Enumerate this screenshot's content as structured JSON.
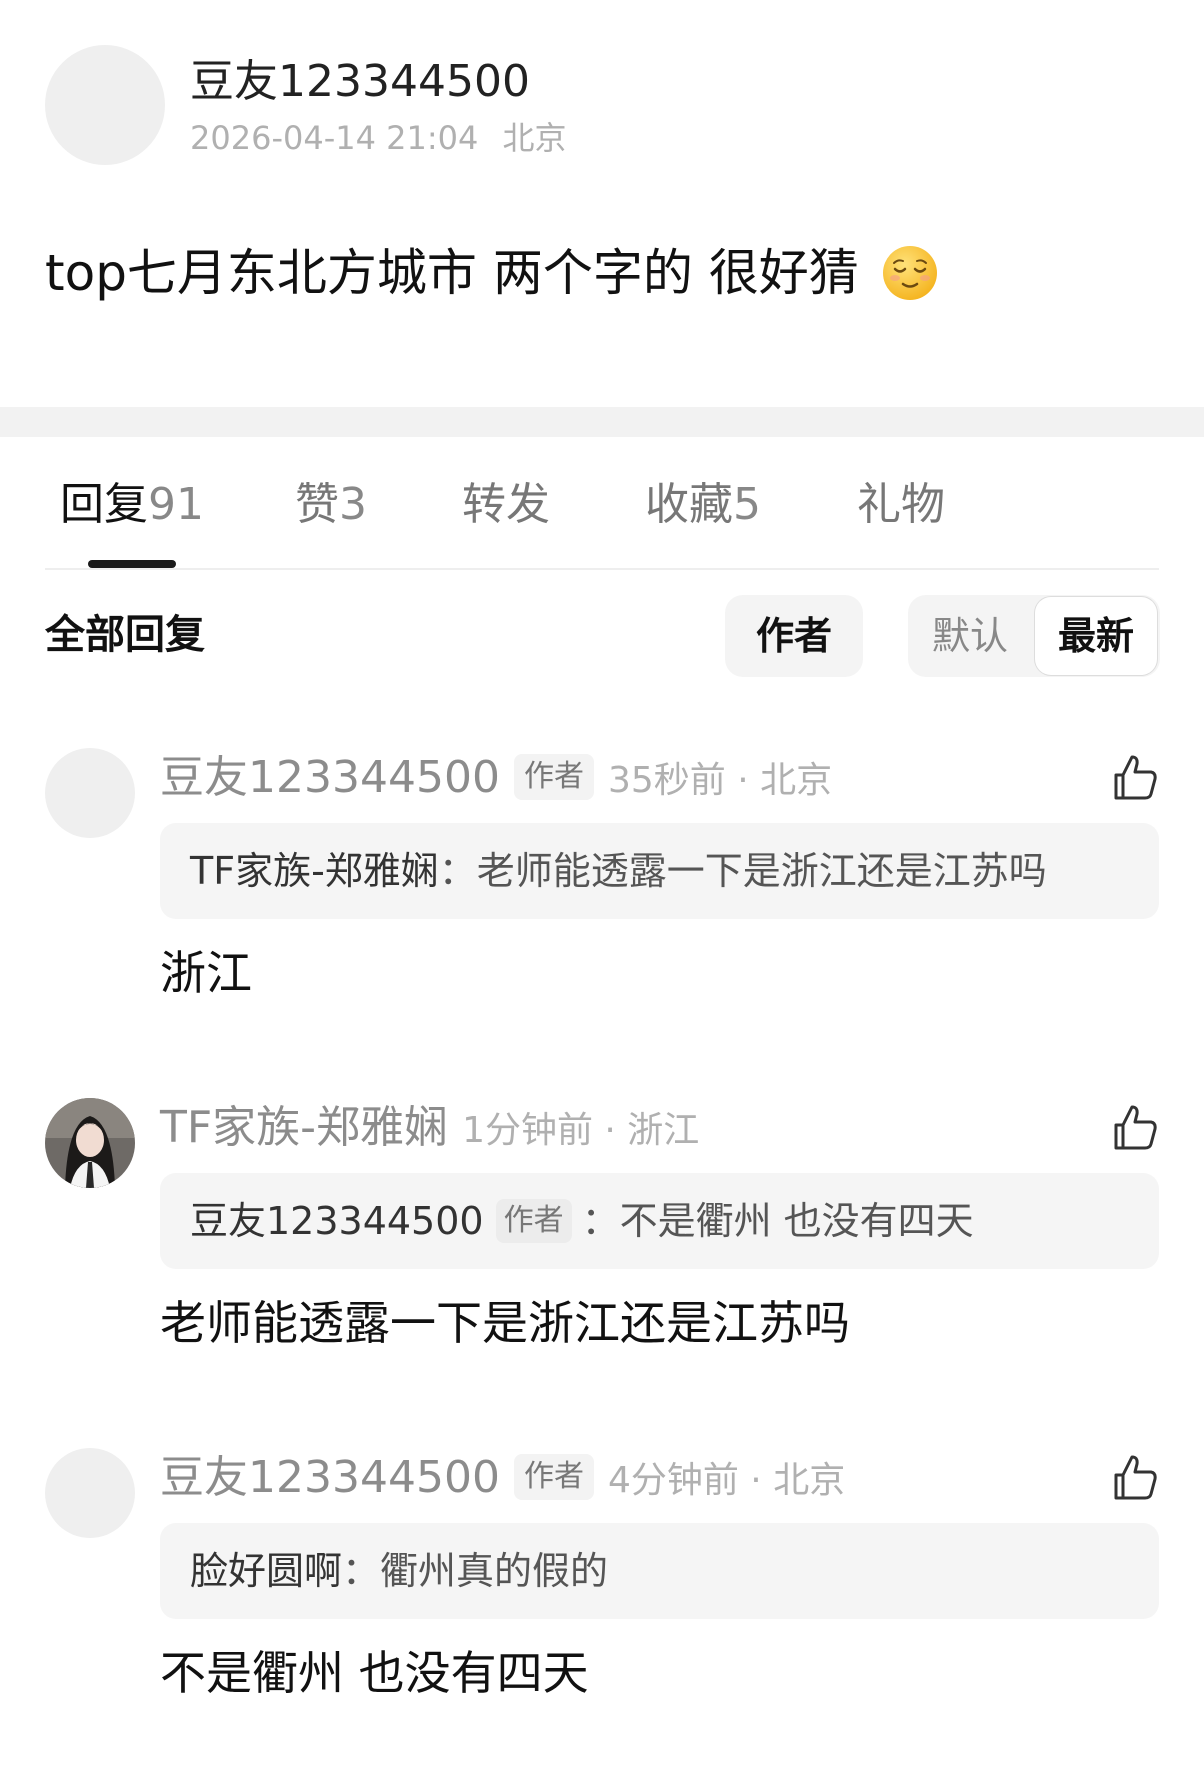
{
  "post": {
    "author": "豆友123344500",
    "timestamp": "2026-04-14 21:04",
    "location": "北京",
    "body": "top七月东北方城市 两个字的 很好猜",
    "emoji": "relieved-face-emoji"
  },
  "tabs": [
    {
      "label": "回复",
      "count": "91",
      "active": true
    },
    {
      "label": "赞",
      "count": "3",
      "active": false
    },
    {
      "label": "转发",
      "count": "",
      "active": false
    },
    {
      "label": "收藏",
      "count": "5",
      "active": false
    },
    {
      "label": "礼物",
      "count": "",
      "active": false
    }
  ],
  "filter": {
    "all_replies_label": "全部回复",
    "author_button": "作者",
    "sort_default": "默认",
    "sort_newest": "最新"
  },
  "comments": [
    {
      "author": "豆友123344500",
      "badge": "作者",
      "time": "35秒前 · 北京",
      "quote_author": "TF家族-郑雅娴",
      "quote_badge": "",
      "quote_text": "：老师能透露一下是浙江还是江苏吗",
      "body": "浙江",
      "avatar": "blank"
    },
    {
      "author": "TF家族-郑雅娴",
      "badge": "",
      "time": "1分钟前 · 浙江",
      "quote_author": "豆友123344500",
      "quote_badge": "作者",
      "quote_text": "：不是衢州 也没有四天",
      "body": "老师能透露一下是浙江还是江苏吗",
      "avatar": "photo"
    },
    {
      "author": "豆友123344500",
      "badge": "作者",
      "time": "4分钟前 · 北京",
      "quote_author": "脸好圆啊",
      "quote_badge": "",
      "quote_text": "：衢州真的假的",
      "body": "不是衢州 也没有四天",
      "avatar": "blank"
    }
  ],
  "icons": {
    "like": "thumbs-up-icon"
  },
  "colors": {
    "background": "#ffffff",
    "muted_text": "#b0b0b0",
    "badge_bg": "#f3f3f3",
    "quote_bg": "#f5f5f5",
    "band": "#f2f2f2"
  }
}
